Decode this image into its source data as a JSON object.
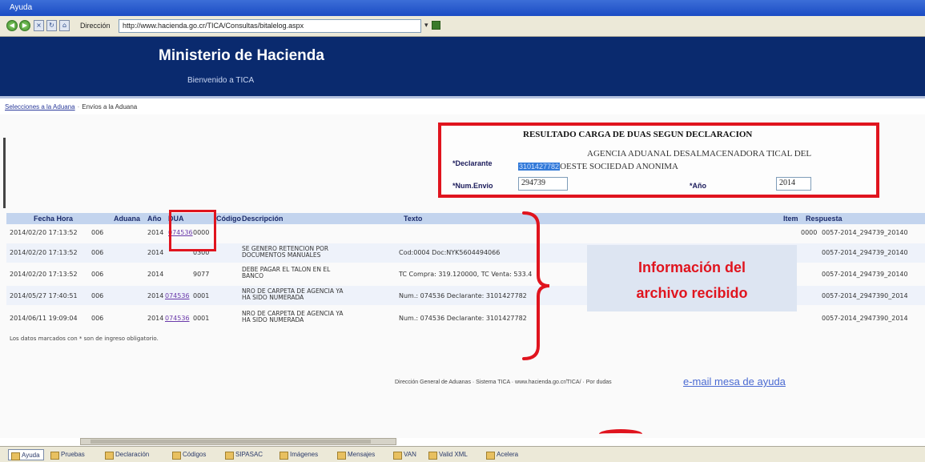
{
  "window": {
    "title": "Ayuda"
  },
  "toolbar": {
    "address_label": "Dirección",
    "address_url": "http://www.hacienda.go.cr/TICA/Consultas/bitalelog.aspx"
  },
  "header": {
    "title": "Ministerio de Hacienda",
    "welcome": "Bienvenido a TICA"
  },
  "breadcrumb": {
    "link": "Selecciones a la Aduana",
    "current": "Envíos a la Aduana"
  },
  "result": {
    "title": "RESULTADO CARGA DE DUAS SEGUN DECLARACION",
    "declarante_label": "*Declarante",
    "declarante_line1": "AGENCIA ADUANAL DESALMACENADORA TICAL DEL",
    "declarante_id": "3101427782",
    "declarante_line2": "OESTE SOCIEDAD ANONIMA",
    "envio_label": "*Num.Envio",
    "envio_value": "294739",
    "anio_label": "*Año",
    "anio_value": "2014"
  },
  "table": {
    "headers": [
      "Fecha Hora",
      "Aduana",
      "Año",
      "DUA",
      "Código",
      "Descripción",
      "Texto",
      "Item",
      "Respuesta"
    ],
    "rows": [
      {
        "fecha": "2014/02/20 17:13:52",
        "aduana": "006",
        "anio": "2014",
        "dua": "074536",
        "codigo": "0000",
        "descripcion": "",
        "texto": "",
        "item": "0000",
        "respuesta": "0057-2014_294739_20140"
      },
      {
        "fecha": "2014/02/20 17:13:52",
        "aduana": "006",
        "anio": "2014",
        "dua": "",
        "codigo": "0300",
        "descripcion": "SE GENERO RETENCION POR DOCUMENTOS MANUALES",
        "texto": "Cod:0004 Doc:NYK5604494066",
        "item": "",
        "respuesta": "0057-2014_294739_20140"
      },
      {
        "fecha": "2014/02/20 17:13:52",
        "aduana": "006",
        "anio": "2014",
        "dua": "",
        "codigo": "9077",
        "descripcion": "DEBE PAGAR EL TALON EN EL BANCO",
        "texto": "TC Compra: 319.120000, TC Venta: 533.4",
        "item": "",
        "respuesta": "0057-2014_294739_20140"
      },
      {
        "fecha": "2014/05/27 17:40:51",
        "aduana": "006",
        "anio": "2014",
        "dua": "074536",
        "codigo": "0001",
        "descripcion": "NRO DE CARPETA DE AGENCIA YA HA SIDO NUMERADA",
        "texto": "Num.: 074536 Declarante: 3101427782",
        "item": "",
        "respuesta": "0057-2014_2947390_2014"
      },
      {
        "fecha": "2014/06/11 19:09:04",
        "aduana": "006",
        "anio": "2014",
        "dua": "074536",
        "codigo": "0001",
        "descripcion": "NRO DE CARPETA DE AGENCIA YA HA SIDO NUMERADA",
        "texto": "Num.: 074536 Declarante: 3101427782",
        "item": "",
        "respuesta": "0057-2014_2947390_2014"
      }
    ],
    "footnote": "Los datos marcados con * son de ingreso obligatorio."
  },
  "callout": {
    "line1": "Información del",
    "line2": "archivo recibido"
  },
  "footer": {
    "text": "Dirección General de Aduanas · Sistema TICA · www.hacienda.go.cr/TICA/ · Por dudas",
    "help_link": "e-mail mesa de ayuda"
  },
  "taskbar": {
    "items": [
      "Ayuda",
      "Pruebas",
      "Declaración",
      "Códigos",
      "SIPASAC",
      "Imágenes",
      "Mensajes",
      "VAN",
      "Valid XML",
      "Acelera"
    ]
  },
  "colors": {
    "accent_red": "#e0141e",
    "banner_blue": "#0a2a6e",
    "table_header": "#c3d4ee"
  }
}
